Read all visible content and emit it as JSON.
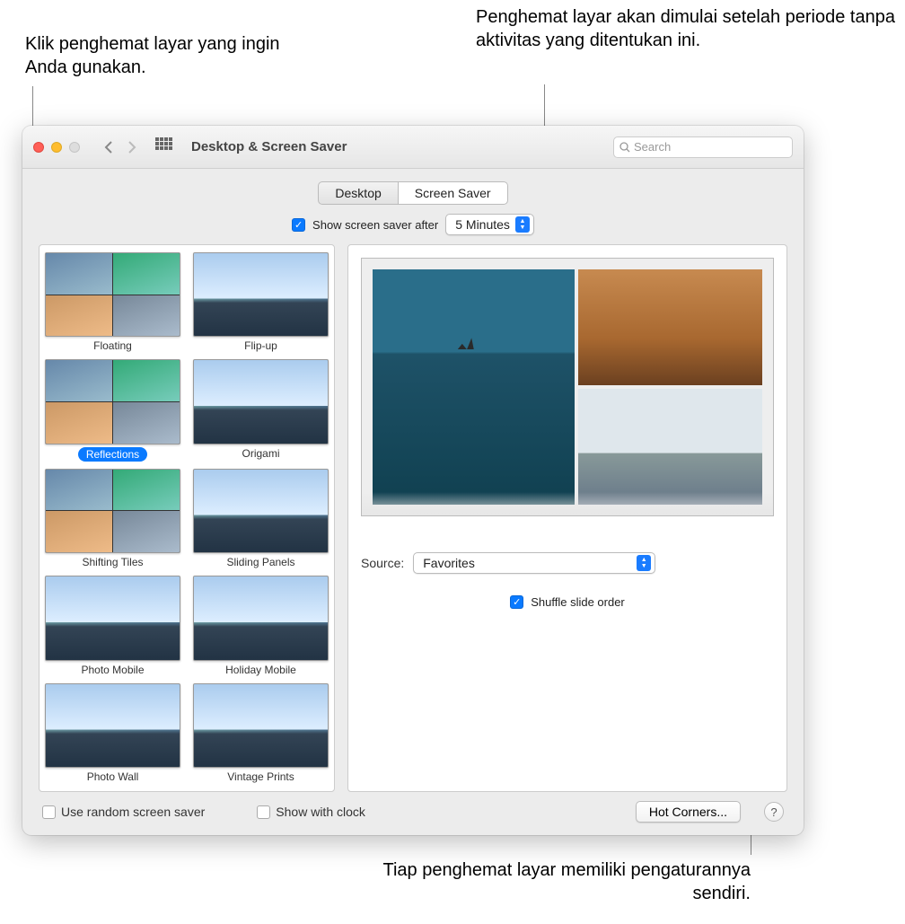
{
  "callouts": {
    "topLeft": "Klik penghemat layar yang ingin Anda gunakan.",
    "topRight": "Penghemat layar akan dimulai setelah periode tanpa aktivitas yang ditentukan ini.",
    "bottom": "Tiap penghemat layar memiliki pengaturannya sendiri."
  },
  "window": {
    "title": "Desktop & Screen Saver",
    "searchPlaceholder": "Search"
  },
  "tabs": {
    "desktop": "Desktop",
    "screensaver": "Screen Saver"
  },
  "showAfter": {
    "checkboxLabel": "Show screen saver after",
    "selected": "5 Minutes"
  },
  "thumbnails": [
    {
      "label": "Floating",
      "style": "grid4",
      "selected": false
    },
    {
      "label": "Flip-up",
      "style": "mountain",
      "selected": false
    },
    {
      "label": "Reflections",
      "style": "grid4",
      "selected": true
    },
    {
      "label": "Origami",
      "style": "mountain",
      "selected": false
    },
    {
      "label": "Shifting Tiles",
      "style": "grid4",
      "selected": false
    },
    {
      "label": "Sliding Panels",
      "style": "mountain",
      "selected": false
    },
    {
      "label": "Photo Mobile",
      "style": "mountain",
      "selected": false
    },
    {
      "label": "Holiday Mobile",
      "style": "mountain",
      "selected": false
    },
    {
      "label": "Photo Wall",
      "style": "mountain",
      "selected": false
    },
    {
      "label": "Vintage Prints",
      "style": "mountain",
      "selected": false
    }
  ],
  "source": {
    "label": "Source:",
    "selected": "Favorites"
  },
  "shuffle": {
    "label": "Shuffle slide order",
    "checked": true
  },
  "bottom": {
    "random": "Use random screen saver",
    "clock": "Show with clock",
    "hotcorners": "Hot Corners...",
    "help": "?"
  }
}
